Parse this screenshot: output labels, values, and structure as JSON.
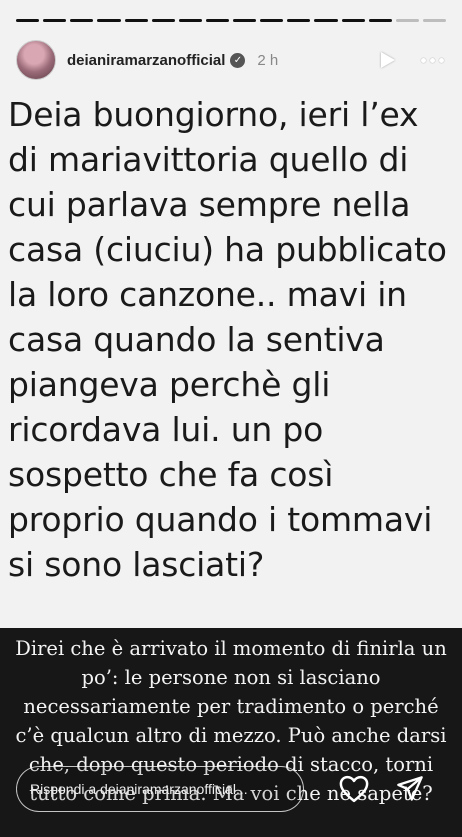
{
  "story": {
    "progress_segments": 16,
    "progress_done": 14,
    "username": "deianiramarzanofficial",
    "time": "2 h",
    "question_text": "Deia buongiorno, ieri l’ex di mariavittoria quello di cui parlava sempre nella casa (ciuciu) ha pubblicato la loro canzone.. mavi in casa quando la sentiva piangeva perchè gli ricordava lui. un po sospetto che fa così proprio quando i tommavi si sono lasciati?",
    "answer_text": "Direi che è arrivato il momento di finirla un po’: le persone non si lasciano necessariamente per tradimento o perché c’è qualcun altro di mezzo. Può anche darsi che, dopo questo periodo di stacco, torni tutto come prima. Ma voi che ne sapete?"
  },
  "reply": {
    "placeholder": "Rispondi a deianiramarzanofficial..."
  },
  "icons": {
    "avatar": "profile-avatar",
    "verified": "verified-badge-icon",
    "play": "play-icon",
    "more": "more-options-icon",
    "like": "heart-icon",
    "send": "send-icon"
  }
}
